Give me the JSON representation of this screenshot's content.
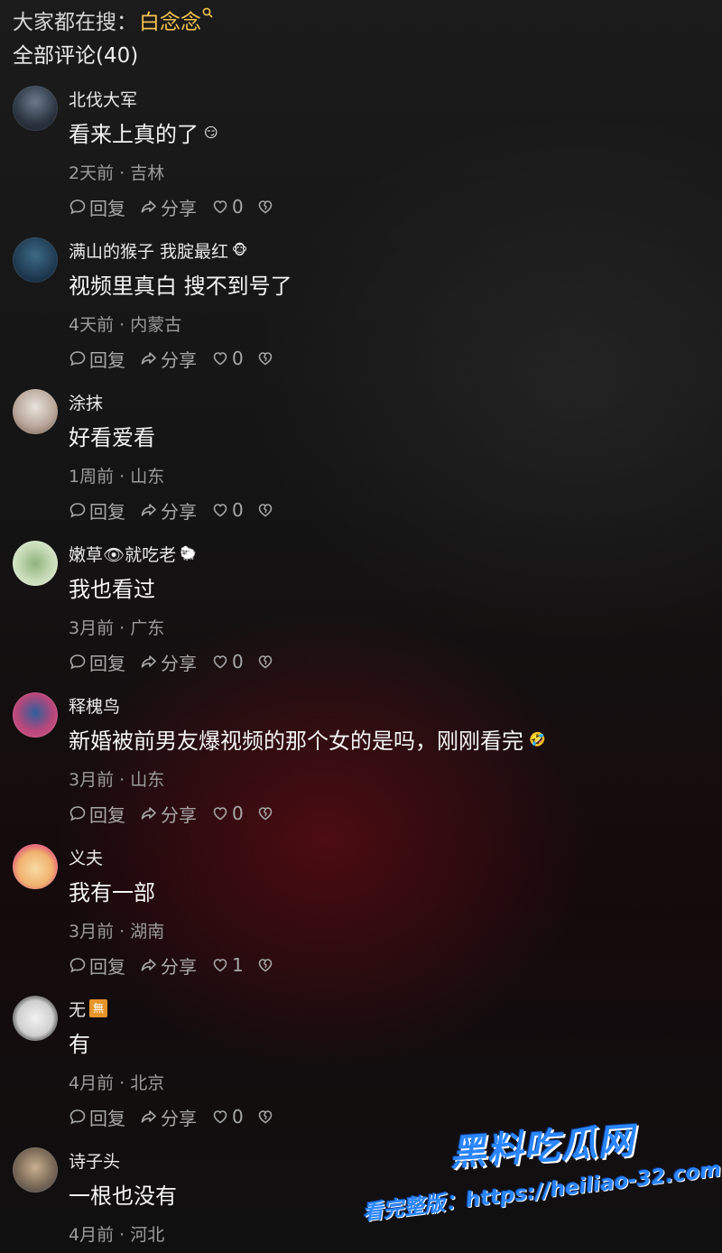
{
  "header": {
    "hot_search_label": "大家都在搜：",
    "hot_search_term": "白念念",
    "hot_search_icon": "search-icon",
    "all_comments": "全部评论(40)"
  },
  "action_labels": {
    "reply": "回复",
    "share": "分享"
  },
  "comments": [
    {
      "name": "北伐大军",
      "name_emoji": "",
      "badge": "",
      "text": "看来上真的了",
      "text_emoji": "😏",
      "meta": "2天前 · 吉林",
      "likes": "0"
    },
    {
      "name": "满山的猴子 我腚最红",
      "name_emoji": "🐵",
      "badge": "",
      "text": "视频里真白  搜不到号了",
      "text_emoji": "",
      "meta": "4天前 · 内蒙古",
      "likes": "0"
    },
    {
      "name": "涂抹",
      "name_emoji": "",
      "badge": "",
      "text": "好看爱看",
      "text_emoji": "",
      "meta": "1周前 · 山东",
      "likes": "0"
    },
    {
      "name": "嫩草👁就吃老",
      "name_emoji": "🐑",
      "badge": "",
      "text": "我也看过",
      "text_emoji": "",
      "meta": "3月前 · 广东",
      "likes": "0"
    },
    {
      "name": "释槐鸟",
      "name_emoji": "",
      "badge": "",
      "text": "新婚被前男友爆视频的那个女的是吗，刚刚看完",
      "text_emoji": "🤣",
      "meta": "3月前 · 山东",
      "likes": "0"
    },
    {
      "name": "义夫",
      "name_emoji": "",
      "badge": "",
      "text": "我有一部",
      "text_emoji": "",
      "meta": "3月前 · 湖南",
      "likes": "1"
    },
    {
      "name": "无",
      "name_emoji": "",
      "badge": "無",
      "text": "有",
      "text_emoji": "",
      "meta": "4月前 · 北京",
      "likes": "0"
    },
    {
      "name": "诗子头",
      "name_emoji": "",
      "badge": "",
      "text": "一根也没有",
      "text_emoji": "",
      "meta": "4月前 · 河北",
      "likes": ""
    }
  ],
  "watermark": {
    "title": "黑料吃瓜网",
    "url": "看完整版：https://heiliao-32.com"
  },
  "colors": {
    "accent_yellow": "#f0c24e",
    "watermark_blue": "#2a86ff",
    "meta_gray": "#9c9c9c"
  }
}
